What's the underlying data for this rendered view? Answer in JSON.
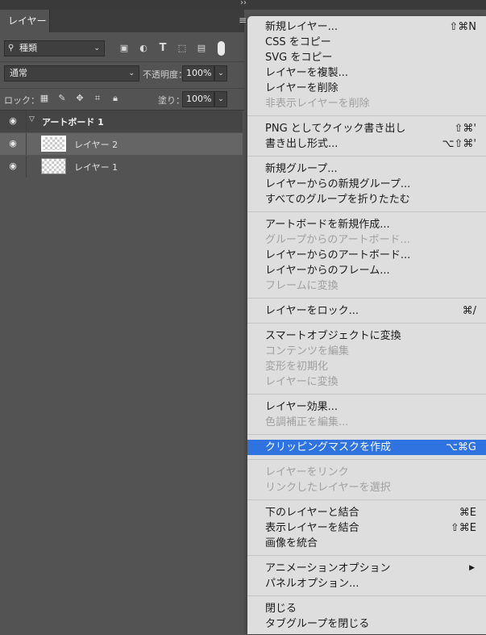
{
  "window": {
    "collapse_glyph": "››"
  },
  "panel": {
    "tab_label": "レイヤー",
    "menu_glyph": "≡",
    "filter": {
      "kind_value": "種類",
      "icons": [
        "image-filter-icon",
        "adjustment-filter-icon",
        "type-filter-icon",
        "shape-filter-icon",
        "smart-object-filter-icon"
      ]
    },
    "blend": {
      "mode_value": "通常",
      "opacity_label": "不透明度：",
      "opacity_value": "100%"
    },
    "lock": {
      "label": "ロック：",
      "fill_label": "塗り：",
      "fill_value": "100%"
    },
    "layers": [
      {
        "name": "アートボード 1",
        "type": "artboard"
      },
      {
        "name": "レイヤー 2",
        "selected": true
      },
      {
        "name": "レイヤー 1"
      }
    ]
  },
  "menu": {
    "items": [
      {
        "label": "新規レイヤー...",
        "shortcut": "⇧⌘N"
      },
      {
        "label": "CSS をコピー"
      },
      {
        "label": "SVG をコピー"
      },
      {
        "label": "レイヤーを複製..."
      },
      {
        "label": "レイヤーを削除"
      },
      {
        "label": "非表示レイヤーを削除",
        "disabled": true
      },
      {
        "label": "PNG としてクイック書き出し",
        "shortcut": "⇧⌘'"
      },
      {
        "label": "書き出し形式...",
        "shortcut": "⌥⇧⌘'"
      },
      {
        "label": "新規グループ..."
      },
      {
        "label": "レイヤーからの新規グループ..."
      },
      {
        "label": "すべてのグループを折りたたむ"
      },
      {
        "label": "アートボードを新規作成..."
      },
      {
        "label": "グループからのアートボード...",
        "disabled": true
      },
      {
        "label": "レイヤーからのアートボード..."
      },
      {
        "label": "レイヤーからのフレーム..."
      },
      {
        "label": "フレームに変換",
        "disabled": true
      },
      {
        "label": "レイヤーをロック...",
        "shortcut": "⌘/"
      },
      {
        "label": "スマートオブジェクトに変換"
      },
      {
        "label": "コンテンツを編集",
        "disabled": true
      },
      {
        "label": "変形を初期化",
        "disabled": true
      },
      {
        "label": "レイヤーに変換",
        "disabled": true
      },
      {
        "label": "レイヤー効果..."
      },
      {
        "label": "色調補正を編集...",
        "disabled": true
      },
      {
        "label": "クリッピングマスクを作成",
        "shortcut": "⌥⌘G",
        "highlighted": true
      },
      {
        "label": "レイヤーをリンク",
        "disabled": true
      },
      {
        "label": "リンクしたレイヤーを選択",
        "disabled": true
      },
      {
        "label": "下のレイヤーと結合",
        "shortcut": "⌘E"
      },
      {
        "label": "表示レイヤーを結合",
        "shortcut": "⇧⌘E"
      },
      {
        "label": "画像を統合"
      },
      {
        "label": "アニメーションオプション",
        "submenu": true
      },
      {
        "label": "パネルオプション..."
      },
      {
        "label": "閉じる"
      },
      {
        "label": "タブグループを閉じる"
      }
    ],
    "submenu_glyph": "▶"
  }
}
